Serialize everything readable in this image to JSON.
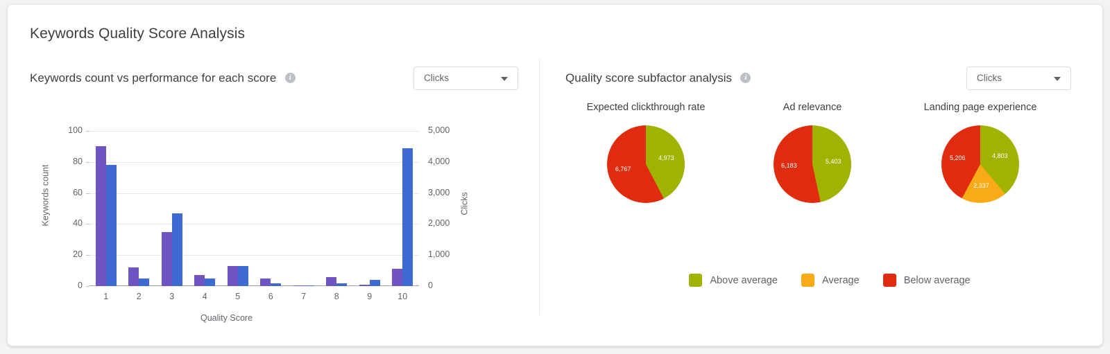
{
  "card": {
    "title": "Keywords Quality Score Analysis"
  },
  "left_panel": {
    "title": "Keywords count vs performance for each score",
    "info_icon": "info-icon",
    "dropdown": {
      "value": "Clicks",
      "caret_icon": "chevron-down-icon"
    }
  },
  "right_panel": {
    "title": "Quality score subfactor analysis",
    "info_icon": "info-icon",
    "dropdown": {
      "value": "Clicks",
      "caret_icon": "chevron-down-icon"
    }
  },
  "colors": {
    "keywords_count_bar": "#6f54c4",
    "clicks_bar": "#3f6ad2",
    "above_average": "#9fb300",
    "average": "#f9ab16",
    "below_average": "#e02b0f"
  },
  "chart_data": [
    {
      "type": "bar",
      "title": "Keywords count vs performance for each score",
      "xlabel": "Quality Score",
      "ylabel": "Keywords count",
      "y2label": "Clicks",
      "categories": [
        "1",
        "2",
        "3",
        "4",
        "5",
        "6",
        "7",
        "8",
        "9",
        "10"
      ],
      "ylim": [
        0,
        100
      ],
      "yticks": [
        "0",
        "20",
        "40",
        "60",
        "80",
        "100"
      ],
      "y2lim": [
        0,
        5000
      ],
      "y2ticks": [
        "0",
        "1,000",
        "2,000",
        "3,000",
        "4,000",
        "5,000"
      ],
      "grid": true,
      "legend": "none",
      "series": [
        {
          "name": "Keywords count",
          "axis": "left",
          "color": "#6f54c4",
          "values": [
            90,
            12,
            35,
            7,
            13,
            5,
            0.5,
            6,
            1,
            11
          ]
        },
        {
          "name": "Clicks",
          "axis": "right",
          "color": "#3f6ad2",
          "values": [
            3900,
            250,
            2350,
            250,
            650,
            100,
            20,
            90,
            200,
            4450
          ]
        }
      ]
    },
    {
      "type": "pie",
      "title": "Expected clickthrough rate",
      "labels": [
        "Above average",
        "Average",
        "Below average"
      ],
      "values": [
        4973,
        0,
        6767
      ],
      "value_labels": [
        "4,973",
        "",
        "6,767"
      ],
      "colors": [
        "#9fb300",
        "#f9ab16",
        "#e02b0f"
      ]
    },
    {
      "type": "pie",
      "title": "Ad relevance",
      "labels": [
        "Above average",
        "Average",
        "Below average"
      ],
      "values": [
        5403,
        0,
        6183
      ],
      "value_labels": [
        "5,403",
        "",
        "6,183"
      ],
      "colors": [
        "#9fb300",
        "#f9ab16",
        "#e02b0f"
      ]
    },
    {
      "type": "pie",
      "title": "Landing page experience",
      "labels": [
        "Above average",
        "Average",
        "Below average"
      ],
      "values": [
        4803,
        2337,
        5206
      ],
      "value_labels": [
        "4,803",
        "2,337",
        "5,206"
      ],
      "colors": [
        "#9fb300",
        "#f9ab16",
        "#e02b0f"
      ]
    }
  ],
  "pie_legend": [
    {
      "label": "Above average",
      "color": "#9fb300"
    },
    {
      "label": "Average",
      "color": "#f9ab16"
    },
    {
      "label": "Below average",
      "color": "#e02b0f"
    }
  ]
}
